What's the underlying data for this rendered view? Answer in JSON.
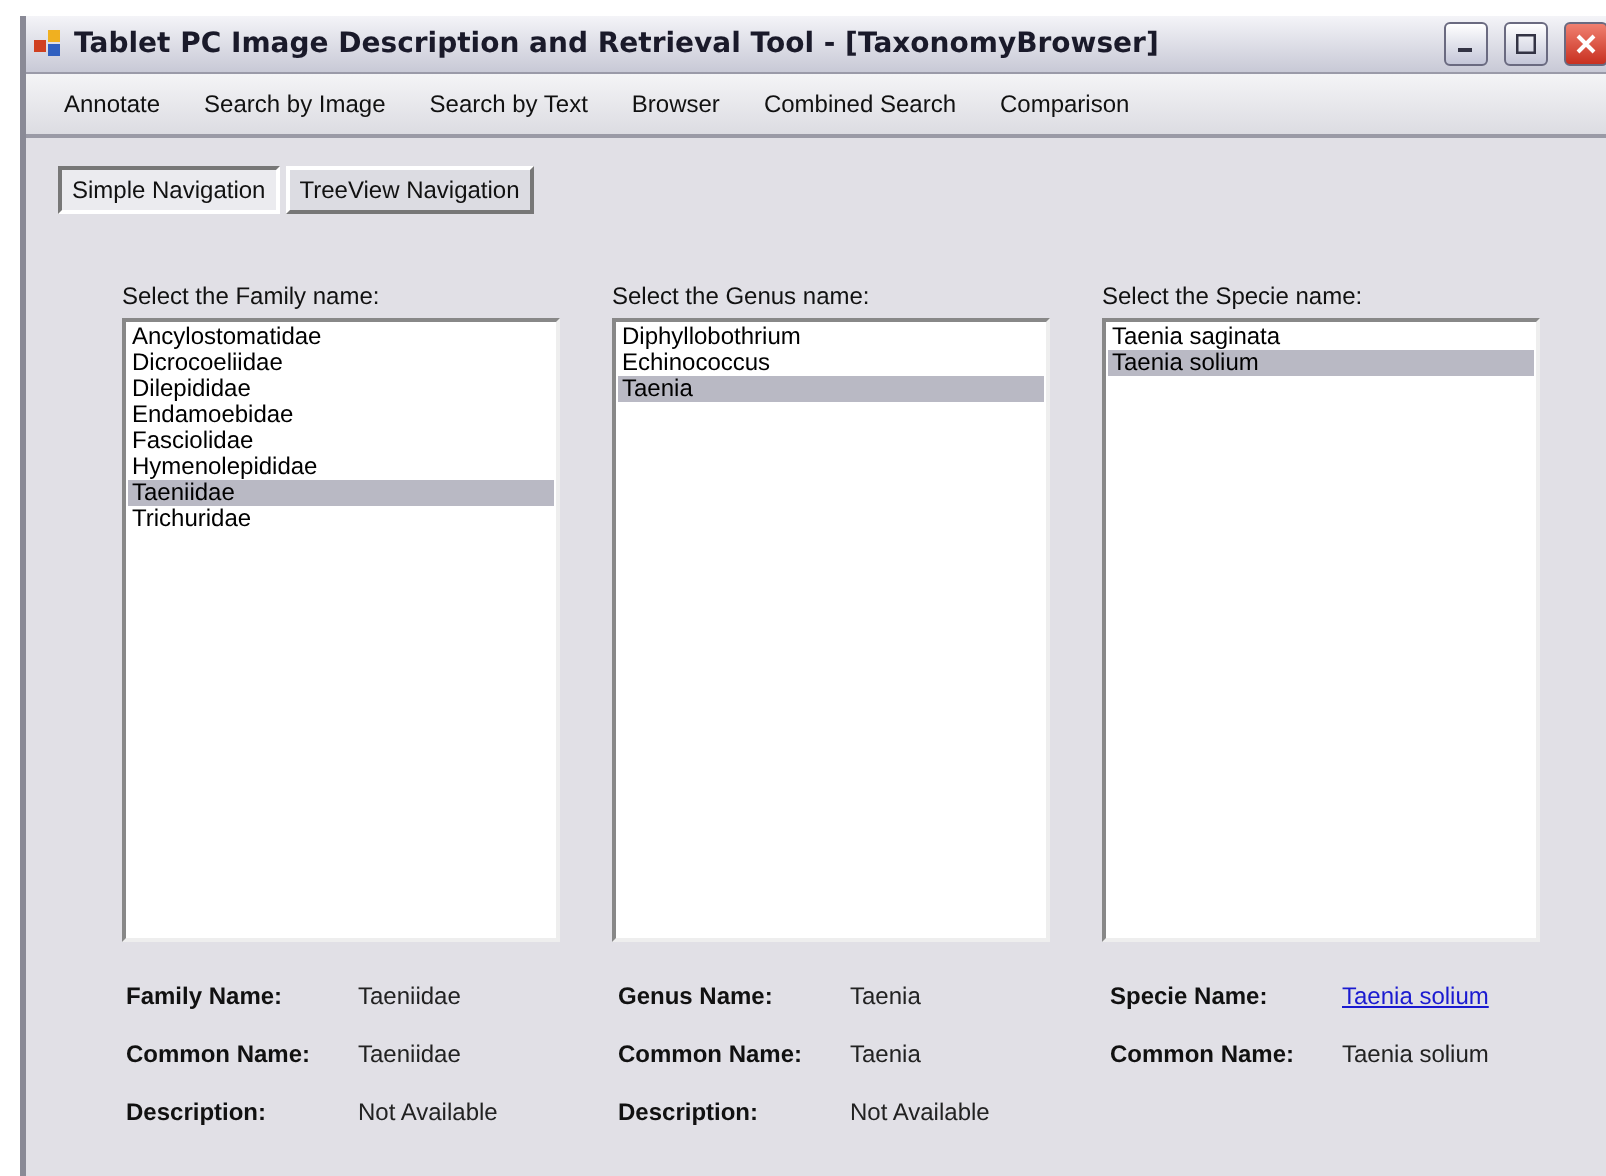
{
  "window": {
    "title": "Tablet PC Image Description and Retrieval Tool - [TaxonomyBrowser]"
  },
  "menu": [
    "Annotate",
    "Search by Image",
    "Search by Text",
    "Browser",
    "Combined Search",
    "Comparison"
  ],
  "tabs": [
    {
      "label": "Simple Navigation",
      "selected": true
    },
    {
      "label": "TreeView Navigation",
      "selected": false
    }
  ],
  "lists": [
    {
      "label": "Select the Family name:",
      "items": [
        {
          "text": "Ancylostomatidae",
          "selected": false
        },
        {
          "text": "Dicrocoeliidae",
          "selected": false
        },
        {
          "text": "Dilepididae",
          "selected": false
        },
        {
          "text": "Endamoebidae",
          "selected": false
        },
        {
          "text": "Fasciolidae",
          "selected": false
        },
        {
          "text": "Hymenolepididae",
          "selected": false
        },
        {
          "text": "Taeniidae",
          "selected": true
        },
        {
          "text": "Trichuridae",
          "selected": false
        }
      ]
    },
    {
      "label": "Select the Genus name:",
      "items": [
        {
          "text": "Diphyllobothrium",
          "selected": false
        },
        {
          "text": "Echinococcus",
          "selected": false
        },
        {
          "text": "Taenia",
          "selected": true
        }
      ]
    },
    {
      "label": "Select the Specie name:",
      "items": [
        {
          "text": "Taenia saginata",
          "selected": false
        },
        {
          "text": "Taenia solium",
          "selected": true
        }
      ]
    }
  ],
  "details": [
    [
      {
        "label": "Family Name:",
        "value": "Taeniidae",
        "kind": "text"
      },
      {
        "label": "Common Name:",
        "value": "Taeniidae",
        "kind": "text"
      },
      {
        "label": "Description:",
        "value": "Not Available",
        "kind": "text"
      }
    ],
    [
      {
        "label": "Genus Name:",
        "value": "Taenia",
        "kind": "text"
      },
      {
        "label": "Common Name:",
        "value": "Taenia",
        "kind": "text"
      },
      {
        "label": "Description:",
        "value": "Not Available",
        "kind": "text"
      }
    ],
    [
      {
        "label": "Specie Name:",
        "value": "Taenia solium",
        "kind": "link"
      },
      {
        "label": "Common Name:",
        "value": "Taenia solium",
        "kind": "text"
      }
    ]
  ]
}
